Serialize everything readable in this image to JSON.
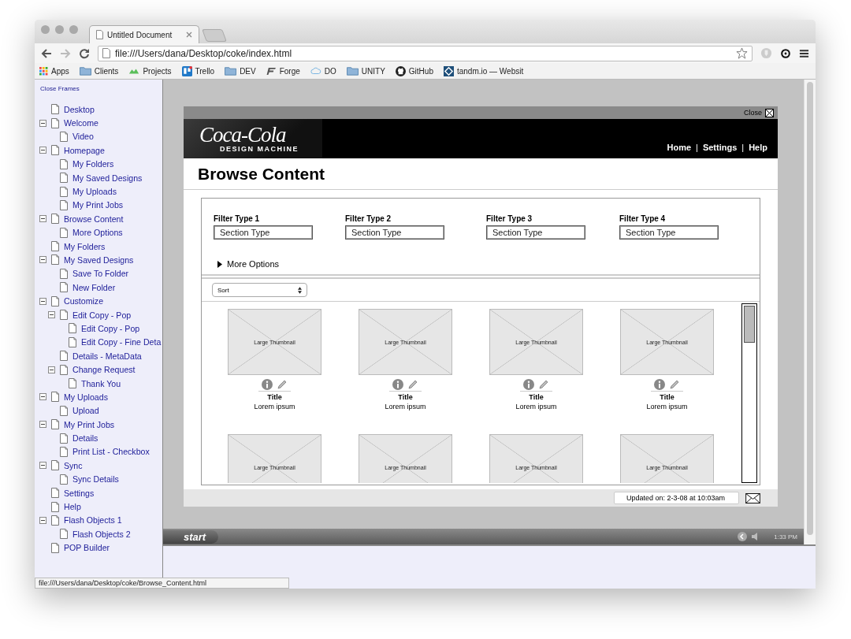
{
  "browser": {
    "tabs": [
      {
        "title": "Untitled Document",
        "selected": true
      }
    ],
    "address": "file:///Users/dana/Desktop/coke/index.html",
    "bookmarks": [
      {
        "label": "Apps",
        "kind": "apps"
      },
      {
        "label": "Clients",
        "kind": "folder"
      },
      {
        "label": "Projects",
        "kind": "cloud-app"
      },
      {
        "label": "Trello",
        "kind": "trello"
      },
      {
        "label": "DEV",
        "kind": "folder"
      },
      {
        "label": "Forge",
        "kind": "forge"
      },
      {
        "label": "DO",
        "kind": "cloud"
      },
      {
        "label": "UNITY",
        "kind": "folder"
      },
      {
        "label": "GitHub",
        "kind": "github"
      },
      {
        "label": "tandm.io — Websit",
        "kind": "tandm"
      }
    ],
    "status_url": "file:///Users/dana/Desktop/coke/Browse_Content.html"
  },
  "sidebar": {
    "close_link": "Close Frames",
    "items": [
      {
        "label": "Desktop"
      },
      {
        "label": "Welcome",
        "expanded": true,
        "children": [
          {
            "label": "Video"
          }
        ]
      },
      {
        "label": "Homepage",
        "expanded": true,
        "children": [
          {
            "label": "My Folders"
          },
          {
            "label": "My Saved Designs"
          },
          {
            "label": "My Uploads"
          },
          {
            "label": "My Print Jobs"
          }
        ]
      },
      {
        "label": "Browse Content",
        "expanded": true,
        "children": [
          {
            "label": "More Options"
          }
        ]
      },
      {
        "label": "My Folders"
      },
      {
        "label": "My Saved Designs",
        "expanded": true,
        "children": [
          {
            "label": "Save To Folder"
          },
          {
            "label": "New Folder"
          }
        ]
      },
      {
        "label": "Customize",
        "expanded": true,
        "children": [
          {
            "label": "Edit Copy - Pop",
            "expanded": true,
            "children": [
              {
                "label": "Edit Copy - Pop"
              },
              {
                "label": "Edit Copy - Fine Deta"
              }
            ]
          },
          {
            "label": "Details - MetaData"
          },
          {
            "label": "Change Request",
            "expanded": true,
            "children": [
              {
                "label": "Thank You"
              }
            ]
          }
        ]
      },
      {
        "label": "My Uploads",
        "expanded": true,
        "children": [
          {
            "label": "Upload"
          }
        ]
      },
      {
        "label": "My Print Jobs",
        "expanded": true,
        "children": [
          {
            "label": "Details"
          },
          {
            "label": "Print List - Checkbox"
          }
        ]
      },
      {
        "label": "Sync",
        "expanded": true,
        "children": [
          {
            "label": "Sync Details"
          }
        ]
      },
      {
        "label": "Settings"
      },
      {
        "label": "Help"
      },
      {
        "label": "Flash Objects 1",
        "expanded": true,
        "children": [
          {
            "label": "Flash Objects 2"
          }
        ]
      },
      {
        "label": "POP Builder"
      }
    ]
  },
  "mockup": {
    "close": "Close",
    "logo": "Coca-Cola",
    "logo_subtitle": "DESIGN MACHINE",
    "nav": [
      {
        "label": "Home",
        "kind": "link"
      },
      {
        "label": "|",
        "kind": "separator"
      },
      {
        "label": "Settings",
        "kind": "link"
      },
      {
        "label": "|",
        "kind": "separator"
      },
      {
        "label": "Help",
        "kind": "link"
      }
    ],
    "heading": "Browse Content",
    "filters": [
      {
        "label": "Filter Type 1",
        "value": "Section Type"
      },
      {
        "label": "Filter Type 2",
        "value": "Section Type"
      },
      {
        "label": "Filter Type 3",
        "value": "Section Type"
      },
      {
        "label": "Filter Type 4",
        "value": "Section Type"
      }
    ],
    "more_options": "More Options",
    "sort": "Sort",
    "thumbnails": [
      {
        "label": "Large Thumbnail",
        "title": "Title",
        "text": "Lorem ipsum"
      },
      {
        "label": "Large Thumbnail",
        "title": "Title",
        "text": "Lorem ipsum"
      },
      {
        "label": "Large Thumbnail",
        "title": "Title",
        "text": "Lorem ipsum"
      },
      {
        "label": "Large Thumbnail",
        "title": "Title",
        "text": "Lorem ipsum"
      },
      {
        "label": "Large Thumbnail"
      },
      {
        "label": "Large Thumbnail"
      },
      {
        "label": "Large Thumbnail"
      },
      {
        "label": "Large Thumbnail"
      }
    ],
    "updated": "Updated on: 2-3-08 at 10:03am"
  },
  "taskbar": {
    "start": "start",
    "time": "1:33 PM"
  }
}
